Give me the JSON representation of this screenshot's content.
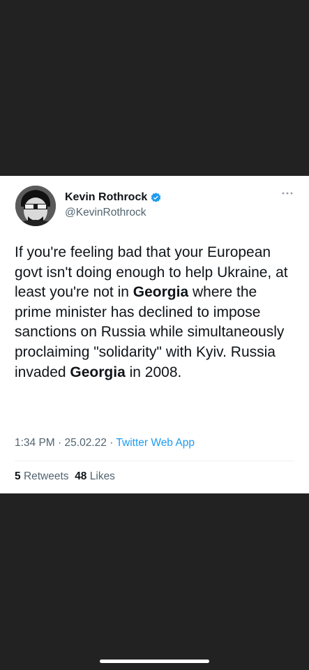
{
  "tweet": {
    "display_name": "Kevin Rothrock",
    "handle": "@KevinRothrock",
    "text_parts": [
      "If you're feeling bad that your European govt isn't doing enough to help Ukraine, at least you're not in ",
      "Georgia",
      " where the prime minister has declined to impose sanctions on Russia while simultaneously proclaiming \"solidarity\" with Kyiv. Russia invaded ",
      "Georgia",
      " in 2008."
    ],
    "time": "1:34 PM",
    "date": "25.02.22",
    "separator": "·",
    "source_app": "Twitter Web App",
    "retweets_count": "5",
    "retweets_label": "Retweets",
    "likes_count": "48",
    "likes_label": "Likes"
  },
  "colors": {
    "background": "#222223",
    "card": "#ffffff",
    "accent": "#1d9bf0",
    "text_primary": "#0f1419",
    "text_secondary": "#536471"
  },
  "icons": {
    "verified": "verified-badge-icon",
    "more": "more-options-icon"
  }
}
